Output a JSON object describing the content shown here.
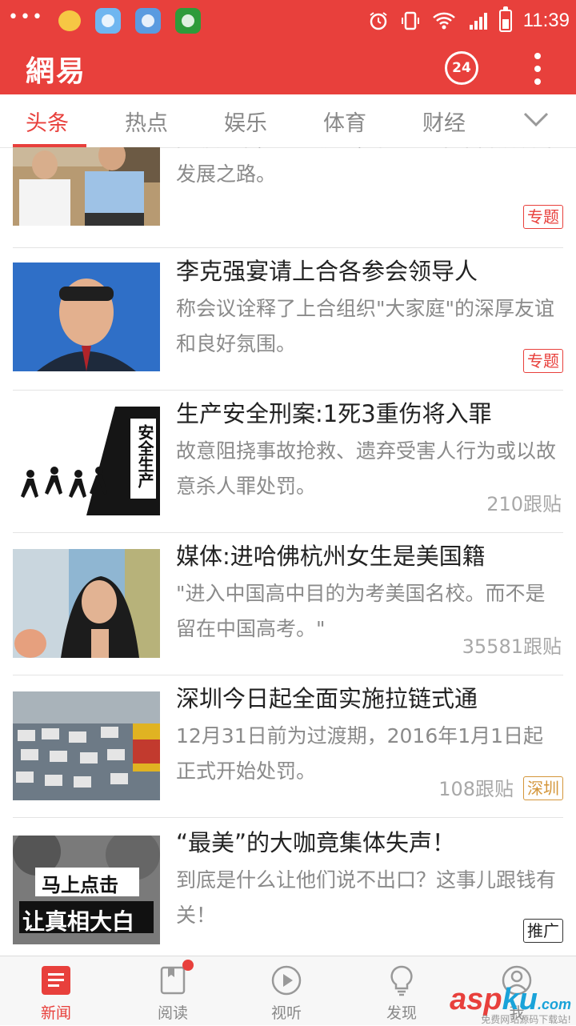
{
  "status_bar": {
    "dots": "•••",
    "time": "11:39",
    "battery_level": 0.6
  },
  "app_bar": {
    "logo": "網易",
    "live_badge": "24"
  },
  "tabs": [
    {
      "label": "头条",
      "active": true
    },
    {
      "label": "热点",
      "active": false
    },
    {
      "label": "娱乐",
      "active": false
    },
    {
      "label": "体育",
      "active": false
    },
    {
      "label": "财经",
      "active": false
    }
  ],
  "feed": [
    {
      "title": "",
      "summary": "高瞻远瞩，呕心沥血，精心为千年古镇设计发展之路。",
      "meta": "",
      "tag": "专题",
      "tag_style": "red"
    },
    {
      "title": "李克强宴请上合各参会领导人",
      "summary": "称会议诠释了上合组织\"大家庭\"的深厚友谊和良好氛围。",
      "meta": "",
      "tag": "专题",
      "tag_style": "red"
    },
    {
      "title": "生产安全刑案:1死3重伤将入罪",
      "summary": "故意阻挠事故抢救、遗弃受害人行为或以故意杀人罪处罚。",
      "meta": "210跟贴",
      "tag": "",
      "tag_style": "",
      "thumb_text": "安全生产"
    },
    {
      "title": "媒体:进哈佛杭州女生是美国籍",
      "summary": "\"进入中国高中目的为考美国名校。而不是留在中国高考。\"",
      "meta": "35581跟贴",
      "tag": "",
      "tag_style": ""
    },
    {
      "title": "深圳今日起全面实施拉链式通",
      "summary": "12月31日前为过渡期，2016年1月1日起正式开始处罚。",
      "meta": "108跟贴",
      "tag": "深圳",
      "tag_style": "orange"
    },
    {
      "title": "“最美”的大咖竟集体失声！",
      "summary": "到底是什么让他们说不出口？这事儿跟钱有关！",
      "meta": "",
      "tag": "推广",
      "tag_style": "dark",
      "thumb_text_1": "马上点击",
      "thumb_text_2": "让真相大白"
    }
  ],
  "bottom_nav": [
    {
      "label": "新闻",
      "icon": "news-icon",
      "active": true
    },
    {
      "label": "阅读",
      "icon": "reading-icon",
      "active": false,
      "badge": true
    },
    {
      "label": "视听",
      "icon": "play-icon",
      "active": false
    },
    {
      "label": "发现",
      "icon": "discover-icon",
      "active": false
    },
    {
      "label": "我",
      "icon": "profile-icon",
      "active": false
    }
  ],
  "watermark": {
    "asp": "asp",
    "ku": "ku",
    "domain": ".com",
    "sub": "免费网站源码下载站!"
  },
  "colors": {
    "brand": "#e8403c",
    "text": "#222222",
    "muted": "#8a8a8a"
  }
}
